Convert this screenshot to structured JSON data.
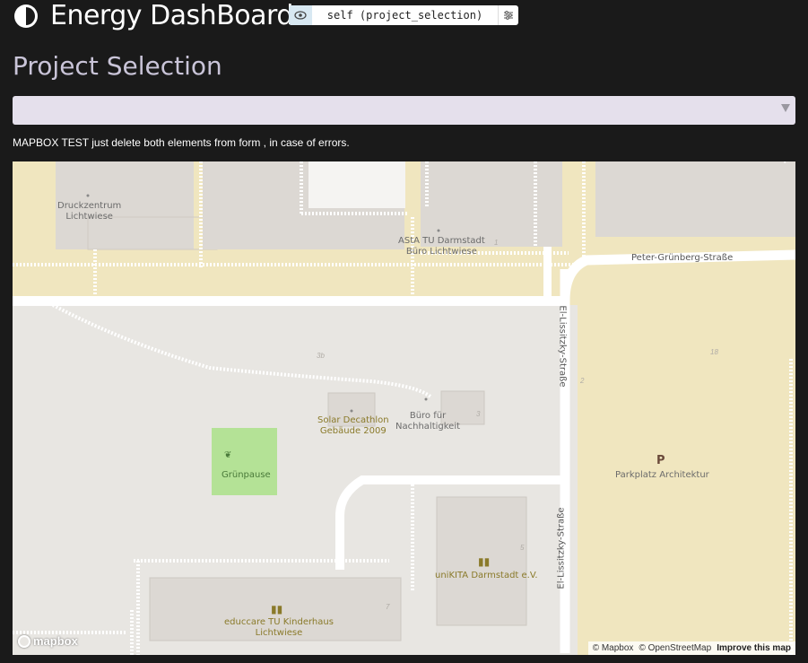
{
  "header": {
    "title": "Energy DashBoard",
    "cell_name": "self (project_selection)",
    "logo_icon": "half-circle-icon",
    "eye_icon": "eye-icon",
    "settings_icon": "sliders-icon"
  },
  "section": {
    "title": "Project Selection"
  },
  "select": {
    "value": ""
  },
  "note": "MAPBOX TEST just delete both elements from form , in case of errors.",
  "map": {
    "labels": {
      "druckzentrum": "Druckzentrum\nLichtwiese",
      "asta": "AStA TU Darmstadt\nBüro Lichtwiese",
      "peter": "Peter-Grünberg-Straße",
      "lissitzky1": "El-Lissitzky-Straße",
      "lissitzky2": "El-Lissitzky-Straße",
      "solar": "Solar Decathlon\nGebäude 2009",
      "buero": "Büro für\nNachhaltigkeit",
      "gruenpause": "Grünpause",
      "parkplatz_p": "P",
      "parkplatz": "Parkplatz Architektur",
      "unikita": "uniKITA Darmstadt e.V.",
      "educcare": "educcare TU Kinderhaus\nLichtwiese"
    },
    "house_numbers": {
      "n3b": "3b",
      "n1": "1",
      "n2": "2",
      "n3": "3",
      "n18": "18",
      "n5": "5",
      "n7": "7"
    },
    "mapbox_logo": "mapbox",
    "attribution": {
      "mapbox": "© Mapbox",
      "osm": "© OpenStreetMap",
      "improve": "Improve this map"
    }
  },
  "colors": {
    "background": "#1a1a1a",
    "select_bg": "#e5e0ec",
    "section_title": "#c9c4d8",
    "map_land": "#e8e6e2",
    "map_sand": "#f0e6bf",
    "map_building": "#dcd8d3",
    "map_green": "#b4e296"
  }
}
